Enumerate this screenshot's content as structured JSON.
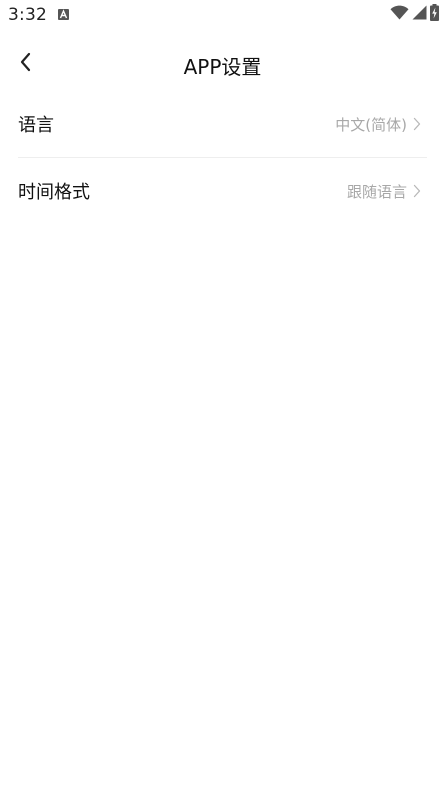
{
  "status_bar": {
    "time": "3:32"
  },
  "nav": {
    "title": "APP设置"
  },
  "settings": [
    {
      "label": "语言",
      "value": "中文(简体)"
    },
    {
      "label": "时间格式",
      "value": "跟随语言"
    }
  ],
  "icons": {
    "back": "chevron-left-icon",
    "row_chevron": "chevron-right-icon",
    "wifi": "wifi-icon",
    "signal": "signal-icon",
    "battery": "battery-charging-icon",
    "notification": "app-notification-icon"
  }
}
